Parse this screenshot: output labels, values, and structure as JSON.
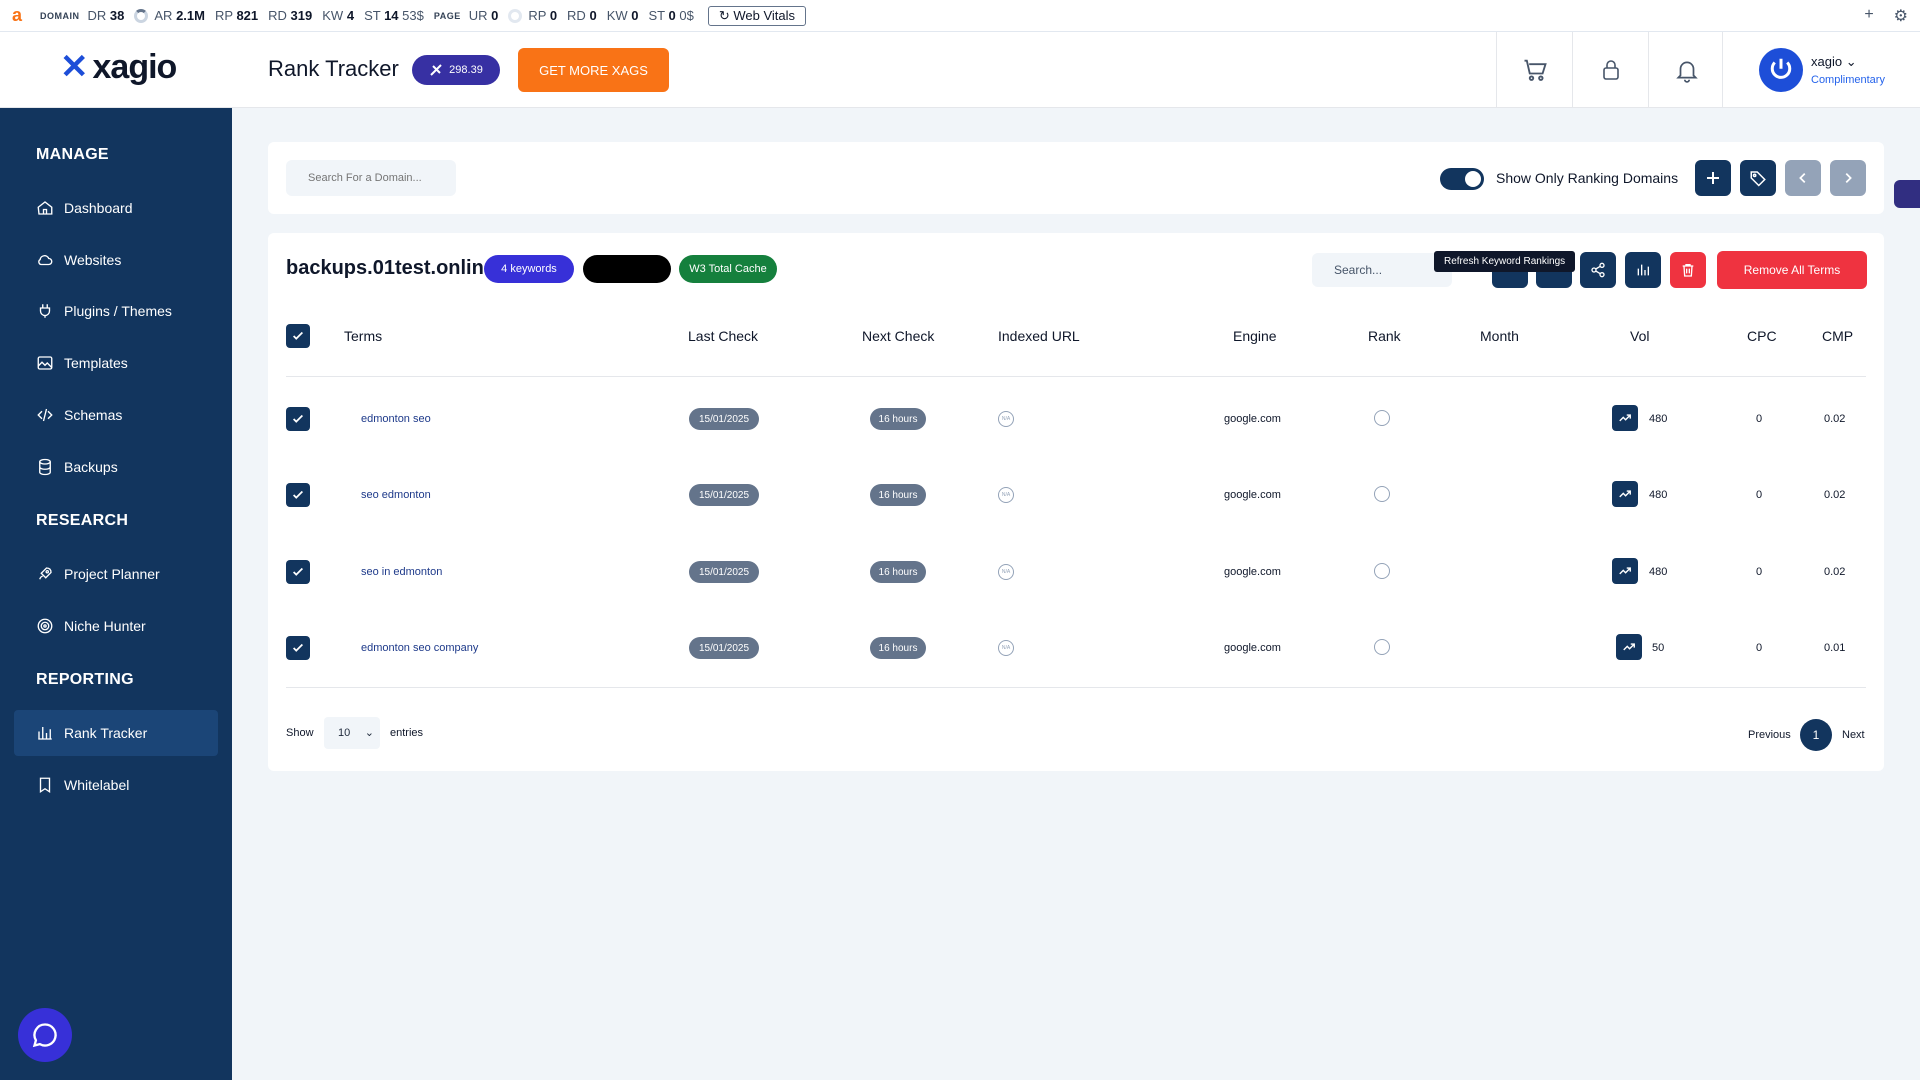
{
  "extbar": {
    "domain_label": "DOMAIN",
    "dr": "DR",
    "dr_val": "38",
    "ar": "AR",
    "ar_val": "2.1M",
    "rp": "RP",
    "rp_val": "821",
    "rd": "RD",
    "rd_val": "319",
    "kw": "KW",
    "kw_val": "4",
    "st": "ST",
    "st_val": "14",
    "st_cost": "53$",
    "page_label": "PAGE",
    "ur": "UR",
    "ur_val": "0",
    "prp": "RP",
    "prp_val": "0",
    "prd": "RD",
    "prd_val": "0",
    "pkw": "KW",
    "pkw_val": "0",
    "pst": "ST",
    "pst_val": "0",
    "pst_cost": "0$",
    "web_vitals": "Web Vitals"
  },
  "header": {
    "logo_text": "xagio",
    "title": "Rank Tracker",
    "xags_balance": "298.39",
    "get_more": "GET MORE XAGS",
    "username": "xagio",
    "plan": "Complimentary"
  },
  "sidebar": {
    "sections": [
      {
        "title": "MANAGE"
      },
      {
        "title": "RESEARCH"
      },
      {
        "title": "REPORTING"
      }
    ],
    "items": [
      {
        "label": "Dashboard",
        "icon": "home-icon"
      },
      {
        "label": "Websites",
        "icon": "cloud-icon"
      },
      {
        "label": "Plugins / Themes",
        "icon": "plug-icon"
      },
      {
        "label": "Templates",
        "icon": "image-icon"
      },
      {
        "label": "Schemas",
        "icon": "code-icon"
      },
      {
        "label": "Backups",
        "icon": "database-icon"
      },
      {
        "label": "Project Planner",
        "icon": "rocket-icon"
      },
      {
        "label": "Niche Hunter",
        "icon": "target-icon"
      },
      {
        "label": "Rank Tracker",
        "icon": "bar-chart-icon",
        "active": true
      },
      {
        "label": "Whitelabel",
        "icon": "bookmark-icon"
      }
    ]
  },
  "toolbar": {
    "search_placeholder": "Search For a Domain...",
    "toggle_label": "Show Only Ranking Domains",
    "toggle_on": true
  },
  "domain_panel": {
    "domain": "backups.01test.online",
    "keywords_badge": "4 keywords",
    "cache_badge": "W3 Total Cache",
    "search_placeholder": "Search...",
    "tooltip": "Refresh Keyword Rankings",
    "remove_all": "Remove All Terms",
    "columns": [
      "Terms",
      "Last Check",
      "Next Check",
      "Indexed URL",
      "Engine",
      "Rank",
      "Month",
      "Vol",
      "CPC",
      "CMP"
    ],
    "rows": [
      {
        "term": "edmonton seo",
        "last_check": "15/01/2025",
        "next_check": "16 hours",
        "indexed": "N/A",
        "engine": "google.com",
        "vol": "480",
        "cpc": "0",
        "cmp": "0.02"
      },
      {
        "term": "seo edmonton",
        "last_check": "15/01/2025",
        "next_check": "16 hours",
        "indexed": "N/A",
        "engine": "google.com",
        "vol": "480",
        "cpc": "0",
        "cmp": "0.02"
      },
      {
        "term": "seo in edmonton",
        "last_check": "15/01/2025",
        "next_check": "16 hours",
        "indexed": "N/A",
        "engine": "google.com",
        "vol": "480",
        "cpc": "0",
        "cmp": "0.02"
      },
      {
        "term": "edmonton seo company",
        "last_check": "15/01/2025",
        "next_check": "16 hours",
        "indexed": "N/A",
        "engine": "google.com",
        "vol": "50",
        "cpc": "0",
        "cmp": "0.01"
      }
    ],
    "show_label": "Show",
    "page_size": "10",
    "entries_label": "entries",
    "prev": "Previous",
    "page": "1",
    "next": "Next"
  },
  "colors": {
    "navy": "#12355e",
    "orange": "#f97316",
    "indigo": "#3730a3",
    "red": "#ef3340",
    "green": "#15803d"
  }
}
